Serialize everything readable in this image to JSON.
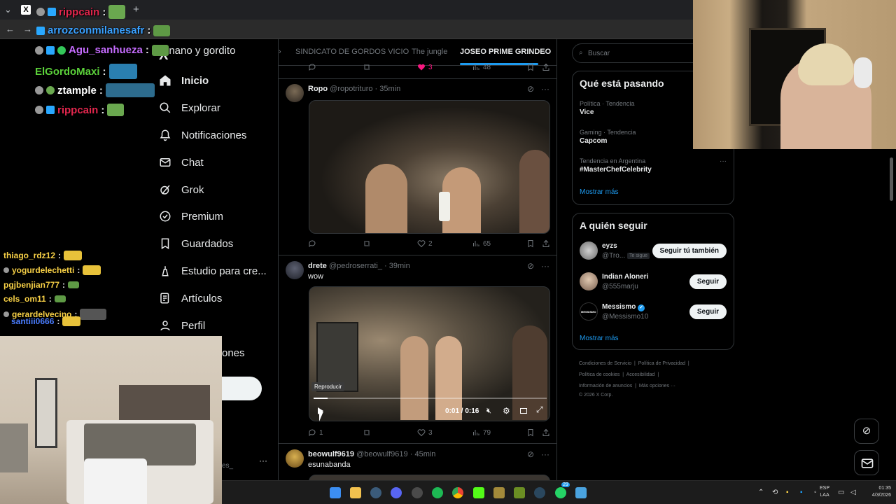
{
  "browser": {
    "new_tab_glyph": "+",
    "x_tab_glyph": "X",
    "nav_back": "←",
    "nav_forward": "→"
  },
  "chat": {
    "top": [
      {
        "user": "rippcain",
        "color": "#e2264d"
      },
      {
        "user": "arrozconmilanesafr",
        "color": "#3aa1ff"
      },
      {
        "user": "Agu_sanhueza",
        "color": "#c66cff"
      },
      {
        "user": "ElGordoMaxi",
        "color": "#5bd13a"
      },
      {
        "user": "ztample",
        "color": "#ffffff"
      },
      {
        "user": "rippcain",
        "color": "#e2264d"
      }
    ],
    "bottom": [
      {
        "user": "thiago_rdz12",
        "color": "#f7d046"
      },
      {
        "user": "yogurdelechetti",
        "color": "#f7d046"
      },
      {
        "user": "pgjbenjian777",
        "color": "#f7d046"
      },
      {
        "user": "cels_om11",
        "color": "#f7d046"
      },
      {
        "user": "gerardelvecino",
        "color": "#f7d046"
      },
      {
        "user": "santiii0666",
        "color": "#4a7dff"
      }
    ],
    "separator": ":"
  },
  "x": {
    "logo": "X",
    "list_title": "enano y gordito",
    "nav": [
      {
        "label": "Inicio",
        "icon": "home-icon"
      },
      {
        "label": "Explorar",
        "icon": "search-icon"
      },
      {
        "label": "Notificaciones",
        "icon": "bell-icon"
      },
      {
        "label": "Chat",
        "icon": "mail-icon"
      },
      {
        "label": "Grok",
        "icon": "grok-icon"
      },
      {
        "label": "Premium",
        "icon": "verified-icon"
      },
      {
        "label": "Guardados",
        "icon": "bookmark-icon"
      },
      {
        "label": "Estudio para cre...",
        "icon": "creator-studio-icon"
      },
      {
        "label": "Artículos",
        "icon": "articles-icon"
      },
      {
        "label": "Perfil",
        "icon": "person-icon"
      }
    ],
    "more_options_partial": "ones",
    "account_ellipsis": "···",
    "handle_partial": "es_"
  },
  "timeline": {
    "tabs": [
      "SINDICATO DE GORDOS VICIO",
      "The jungle",
      "JOSEO PRIME GRINDEO"
    ],
    "tab_left_arrow": "›",
    "top_actions": {
      "likes": "3",
      "views": "48"
    },
    "posts": [
      {
        "name": "Ropo",
        "handle": "@ropotrituro",
        "time": "35min",
        "text": "",
        "replies": "",
        "reposts": "",
        "likes": "2",
        "views": "65"
      },
      {
        "name": "drete",
        "handle": "@pedroserrati_",
        "time": "39min",
        "text": "wow",
        "replies": "1",
        "reposts": "",
        "likes": "3",
        "views": "79",
        "video": {
          "tooltip": "Reproducir",
          "time": "0:01 / 0:16",
          "progress": 0.06
        }
      },
      {
        "name": "beowulf9619",
        "handle": "@beowulf9619",
        "time": "45min",
        "text": "esunabanda"
      }
    ],
    "dot": "·"
  },
  "sidebar": {
    "search_placeholder": "Buscar",
    "trends_title": "Qué está pasando",
    "trends": [
      {
        "meta": "Política · Tendencia",
        "name": "Vice"
      },
      {
        "meta": "Gaming · Tendencia",
        "name": "Capcom"
      },
      {
        "meta": "Tendencia en Argentina",
        "name": "#MasterChefCelebrity"
      }
    ],
    "show_more": "Mostrar más",
    "follow_title": "A quién seguir",
    "follows": [
      {
        "name": "eyzs",
        "handle": "@Tro...",
        "follows_you": "Te sigue",
        "button": "Seguir tú también"
      },
      {
        "name": "Indian Aloneri",
        "handle": "@555marju",
        "button": "Seguir"
      },
      {
        "name": "Messismo",
        "handle": "@Messismo10",
        "button": "Seguir",
        "avatar_text": "MESSISMO"
      }
    ],
    "footer": [
      [
        "Condiciones de Servicio",
        "Política de Privacidad"
      ],
      [
        "Política de cookies",
        "Accesibilidad"
      ],
      [
        "Información de anuncios",
        "Más opciones ···"
      ],
      [
        "© 2026 X Corp."
      ]
    ]
  },
  "taskbar": {
    "lang_top": "ESP",
    "lang_bottom": "LAA",
    "time": "01:35",
    "date": "4/3/2026",
    "badge": "29"
  },
  "colors": {
    "accent": "#1d9bf0",
    "heart": "#f91880"
  }
}
